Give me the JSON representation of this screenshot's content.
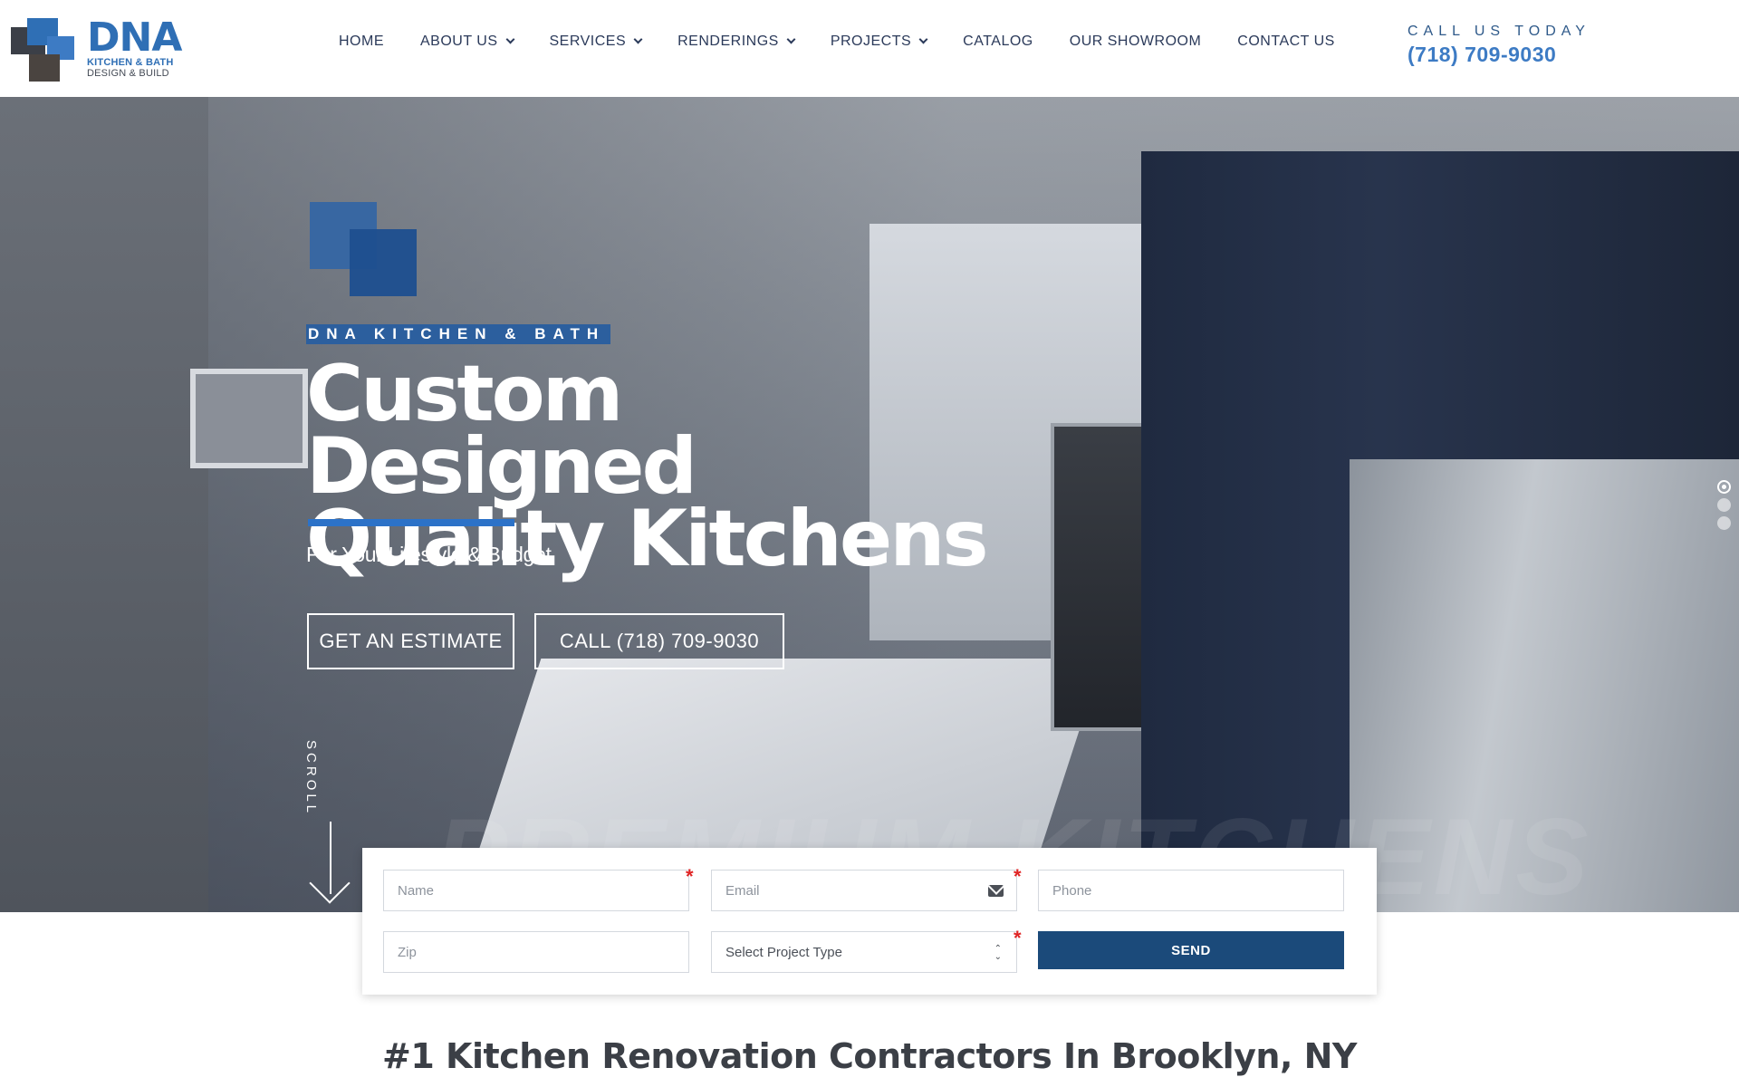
{
  "brand": {
    "logo_text": "DNA",
    "logo_line1": "KITCHEN & BATH",
    "logo_line2": "DESIGN & BUILD",
    "primary_color": "#2f6fb5",
    "dark_blue": "#1b4a7a"
  },
  "nav": {
    "items": [
      {
        "label": "HOME",
        "has_dropdown": false
      },
      {
        "label": "ABOUT US",
        "has_dropdown": true
      },
      {
        "label": "SERVICES",
        "has_dropdown": true
      },
      {
        "label": "RENDERINGS",
        "has_dropdown": true
      },
      {
        "label": "PROJECTS",
        "has_dropdown": true
      },
      {
        "label": "CATALOG",
        "has_dropdown": false
      },
      {
        "label": "OUR SHOWROOM",
        "has_dropdown": false
      },
      {
        "label": "CONTACT US",
        "has_dropdown": false
      }
    ]
  },
  "call": {
    "label": "CALL US TODAY",
    "phone": "(718) 709-9030"
  },
  "hero": {
    "eyebrow": "DNA KITCHEN & BATH",
    "title_line1": "Custom Designed",
    "title_line2": "Quality Kitchens",
    "subtitle": "For Your Lifestyle & Budget",
    "estimate_button": "GET AN ESTIMATE",
    "call_button": "CALL (718) 709-9030",
    "scroll_label": "SCROLL",
    "watermark": "PREMIUM KITCHENS",
    "slides": 3,
    "active_slide": 1
  },
  "form": {
    "name_placeholder": "Name",
    "email_placeholder": "Email",
    "phone_placeholder": "Phone",
    "zip_placeholder": "Zip",
    "project_type_selected": "Select Project Type",
    "required_mark": "*",
    "send_label": "SEND"
  },
  "section": {
    "headline": "#1 Kitchen Renovation Contractors In Brooklyn, NY"
  },
  "icons": {
    "dropdown": "chevron-down-icon",
    "email": "envelope-icon",
    "select": "select-arrows-icon",
    "scroll": "arrow-down-icon"
  }
}
